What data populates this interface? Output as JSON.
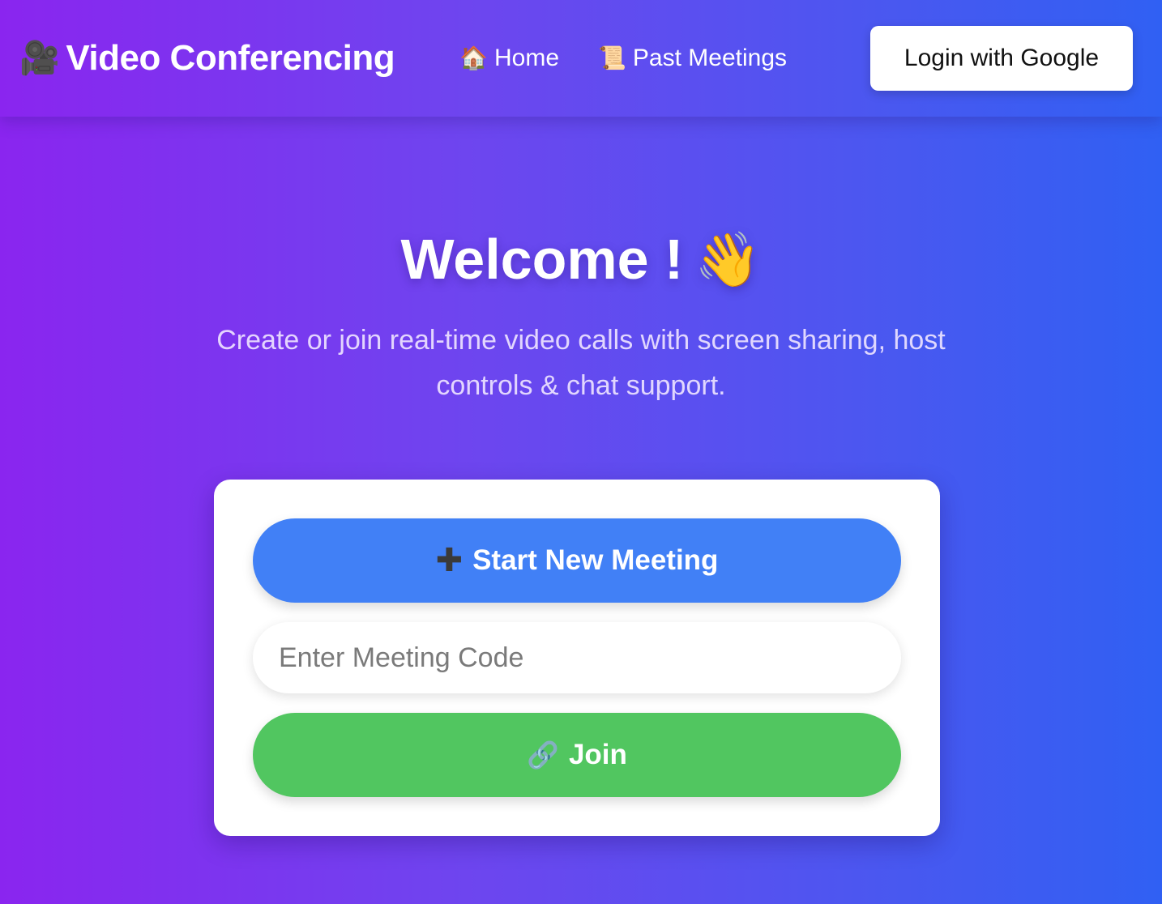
{
  "navbar": {
    "brand": {
      "icon": "🎥",
      "icon_name": "movie-camera-icon",
      "title": "Video Conferencing"
    },
    "links": [
      {
        "icon": "🏠",
        "icon_name": "house-icon",
        "label": "Home"
      },
      {
        "icon": "📜",
        "icon_name": "scroll-icon",
        "label": "Past Meetings"
      }
    ],
    "login_label": "Login with Google"
  },
  "hero": {
    "title": "Welcome !",
    "title_icon": "👋",
    "title_icon_name": "waving-hand-icon",
    "subtitle": "Create or join real-time video calls with screen sharing, host controls & chat support."
  },
  "card": {
    "start_icon": "✚",
    "start_icon_name": "plus-icon",
    "start_label": "Start New Meeting",
    "code_placeholder": "Enter Meeting Code",
    "code_value": "",
    "join_icon": "🔗",
    "join_icon_name": "link-icon",
    "join_label": "Join"
  },
  "colors": {
    "gradient_start": "#8a25ef",
    "gradient_end": "#3060f3",
    "start_button": "#4180f6",
    "join_button": "#51c660"
  }
}
